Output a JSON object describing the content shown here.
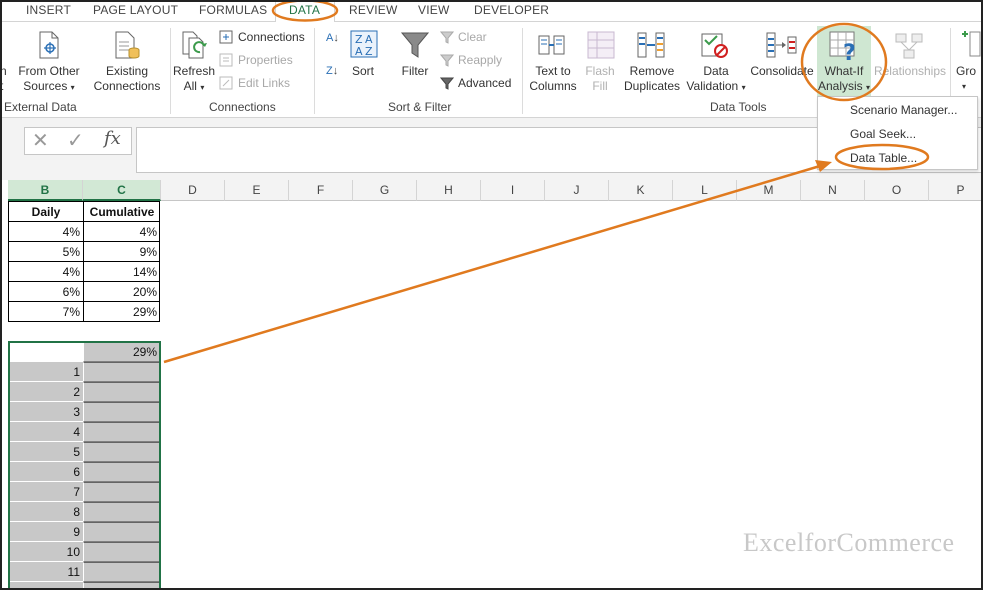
{
  "tabs": [
    "INSERT",
    "PAGE LAYOUT",
    "FORMULAS",
    "DATA",
    "REVIEW",
    "VIEW",
    "DEVELOPER"
  ],
  "ribbon": {
    "get_external": {
      "partial_line1": "n",
      "partial_line2": "t",
      "from_other": "From Other",
      "sources": "Sources",
      "existing": "Existing",
      "connections": "Connections",
      "group": "External Data"
    },
    "connections": {
      "refresh": "Refresh",
      "all": "All",
      "connections": "Connections",
      "properties": "Properties",
      "edit_links": "Edit Links",
      "group": "Connections"
    },
    "sort_filter": {
      "sort": "Sort",
      "filter": "Filter",
      "clear": "Clear",
      "reapply": "Reapply",
      "advanced": "Advanced",
      "group": "Sort & Filter",
      "az": "A",
      "za": "Z"
    },
    "data_tools": {
      "text_to": "Text to",
      "columns": "Columns",
      "flash": "Flash",
      "fill": "Fill",
      "remove": "Remove",
      "duplicates": "Duplicates",
      "data": "Data",
      "validation": "Validation",
      "consolidate": "Consolidate",
      "whatif": "What-If",
      "analysis": "Analysis",
      "relationships": "Relationships",
      "group": "Data Tools"
    },
    "outline": {
      "group_partial": "Gro"
    }
  },
  "formula_bar": {
    "cancel": "✕",
    "enter": "✓",
    "fx": "fx",
    "value": ""
  },
  "columns": [
    "B",
    "C",
    "D",
    "E",
    "F",
    "G",
    "H",
    "I",
    "J",
    "K",
    "L",
    "M",
    "N",
    "O",
    "P"
  ],
  "table": {
    "headers": [
      "Daily",
      "Cumulative"
    ],
    "rows": [
      [
        "4%",
        "4%"
      ],
      [
        "5%",
        "9%"
      ],
      [
        "4%",
        "14%"
      ],
      [
        "6%",
        "20%"
      ],
      [
        "7%",
        "29%"
      ]
    ]
  },
  "data_table": {
    "top_value": "29%",
    "row_labels": [
      "1",
      "2",
      "3",
      "4",
      "5",
      "6",
      "7",
      "8",
      "9",
      "10",
      "11"
    ]
  },
  "whatif_menu": [
    "Scenario Manager...",
    "Goal Seek...",
    "Data Table..."
  ],
  "watermark": "ExcelforCommerce",
  "colors": {
    "excel_green": "#217346",
    "annotation": "#e07a1f",
    "selection_fill": "#c8c8c8"
  }
}
